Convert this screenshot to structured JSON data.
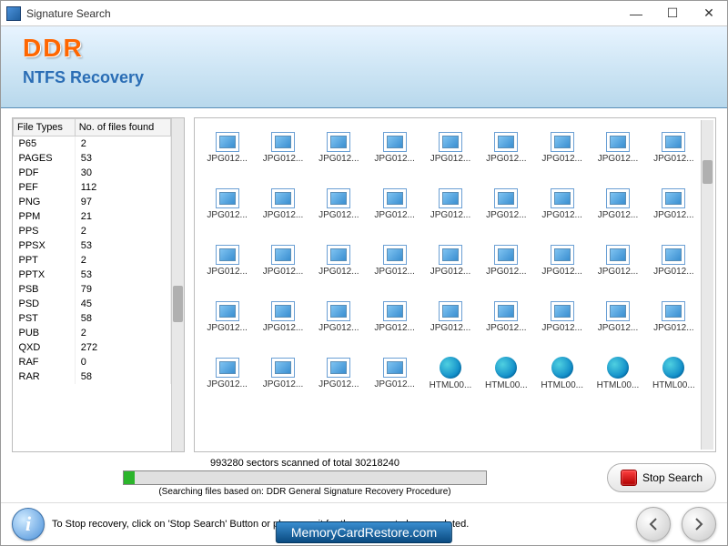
{
  "titlebar": {
    "title": "Signature Search",
    "minimize": "—",
    "maximize": "☐",
    "close": "✕"
  },
  "banner": {
    "logo": "DDR",
    "subtitle": "NTFS Recovery"
  },
  "filetypes": {
    "header_type": "File Types",
    "header_count": "No. of files found",
    "rows": [
      {
        "type": "P65",
        "count": 2
      },
      {
        "type": "PAGES",
        "count": 53
      },
      {
        "type": "PDF",
        "count": 30
      },
      {
        "type": "PEF",
        "count": 112
      },
      {
        "type": "PNG",
        "count": 97
      },
      {
        "type": "PPM",
        "count": 21
      },
      {
        "type": "PPS",
        "count": 2
      },
      {
        "type": "PPSX",
        "count": 53
      },
      {
        "type": "PPT",
        "count": 2
      },
      {
        "type": "PPTX",
        "count": 53
      },
      {
        "type": "PSB",
        "count": 79
      },
      {
        "type": "PSD",
        "count": 45
      },
      {
        "type": "PST",
        "count": 58
      },
      {
        "type": "PUB",
        "count": 2
      },
      {
        "type": "QXD",
        "count": 272
      },
      {
        "type": "RAF",
        "count": 0
      },
      {
        "type": "RAR",
        "count": 58
      }
    ]
  },
  "files": [
    {
      "name": "JPG012...",
      "kind": "img"
    },
    {
      "name": "JPG012...",
      "kind": "img"
    },
    {
      "name": "JPG012...",
      "kind": "img"
    },
    {
      "name": "JPG012...",
      "kind": "img"
    },
    {
      "name": "JPG012...",
      "kind": "img"
    },
    {
      "name": "JPG012...",
      "kind": "img"
    },
    {
      "name": "JPG012...",
      "kind": "img"
    },
    {
      "name": "JPG012...",
      "kind": "img"
    },
    {
      "name": "JPG012...",
      "kind": "img"
    },
    {
      "name": "JPG012...",
      "kind": "img"
    },
    {
      "name": "JPG012...",
      "kind": "img"
    },
    {
      "name": "JPG012...",
      "kind": "img"
    },
    {
      "name": "JPG012...",
      "kind": "img"
    },
    {
      "name": "JPG012...",
      "kind": "img"
    },
    {
      "name": "JPG012...",
      "kind": "img"
    },
    {
      "name": "JPG012...",
      "kind": "img"
    },
    {
      "name": "JPG012...",
      "kind": "img"
    },
    {
      "name": "JPG012...",
      "kind": "img"
    },
    {
      "name": "JPG012...",
      "kind": "img"
    },
    {
      "name": "JPG012...",
      "kind": "img"
    },
    {
      "name": "JPG012...",
      "kind": "img"
    },
    {
      "name": "JPG012...",
      "kind": "img"
    },
    {
      "name": "JPG012...",
      "kind": "img"
    },
    {
      "name": "JPG012...",
      "kind": "img"
    },
    {
      "name": "JPG012...",
      "kind": "img"
    },
    {
      "name": "JPG012...",
      "kind": "img"
    },
    {
      "name": "JPG012...",
      "kind": "img"
    },
    {
      "name": "JPG012...",
      "kind": "img"
    },
    {
      "name": "JPG012...",
      "kind": "img"
    },
    {
      "name": "JPG012...",
      "kind": "img"
    },
    {
      "name": "JPG012...",
      "kind": "img"
    },
    {
      "name": "JPG012...",
      "kind": "img"
    },
    {
      "name": "JPG012...",
      "kind": "img"
    },
    {
      "name": "JPG012...",
      "kind": "img"
    },
    {
      "name": "JPG012...",
      "kind": "img"
    },
    {
      "name": "JPG012...",
      "kind": "img"
    },
    {
      "name": "JPG012...",
      "kind": "img"
    },
    {
      "name": "JPG012...",
      "kind": "img"
    },
    {
      "name": "JPG012...",
      "kind": "img"
    },
    {
      "name": "JPG012...",
      "kind": "img"
    },
    {
      "name": "HTML00...",
      "kind": "html"
    },
    {
      "name": "HTML00...",
      "kind": "html"
    },
    {
      "name": "HTML00...",
      "kind": "html"
    },
    {
      "name": "HTML00...",
      "kind": "html"
    },
    {
      "name": "HTML00...",
      "kind": "html"
    }
  ],
  "progress": {
    "status": "993280 sectors scanned of total 30218240",
    "percent": 3,
    "note": "(Searching files based on:  DDR General Signature Recovery Procedure)",
    "stop_label": "Stop Search"
  },
  "footer": {
    "hint": "To Stop recovery, click on 'Stop Search' Button or please wait for the process to be completed.",
    "site": "MemoryCardRestore.com"
  }
}
